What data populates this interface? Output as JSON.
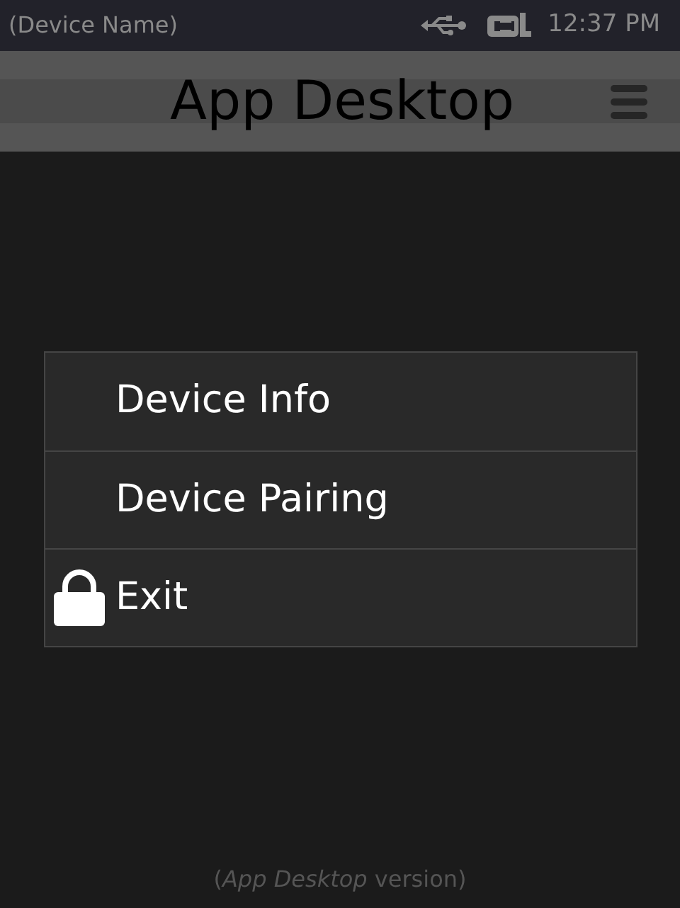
{
  "status_bar": {
    "device_name": "(Device Name)",
    "time": "12:37 PM"
  },
  "header": {
    "title": "App Desktop"
  },
  "menu": [
    {
      "label": "Device Info",
      "locked": false
    },
    {
      "label": "Device Pairing",
      "locked": false
    },
    {
      "label": "Exit",
      "locked": true
    }
  ],
  "footer": {
    "version": "(*App Desktop* version)"
  }
}
